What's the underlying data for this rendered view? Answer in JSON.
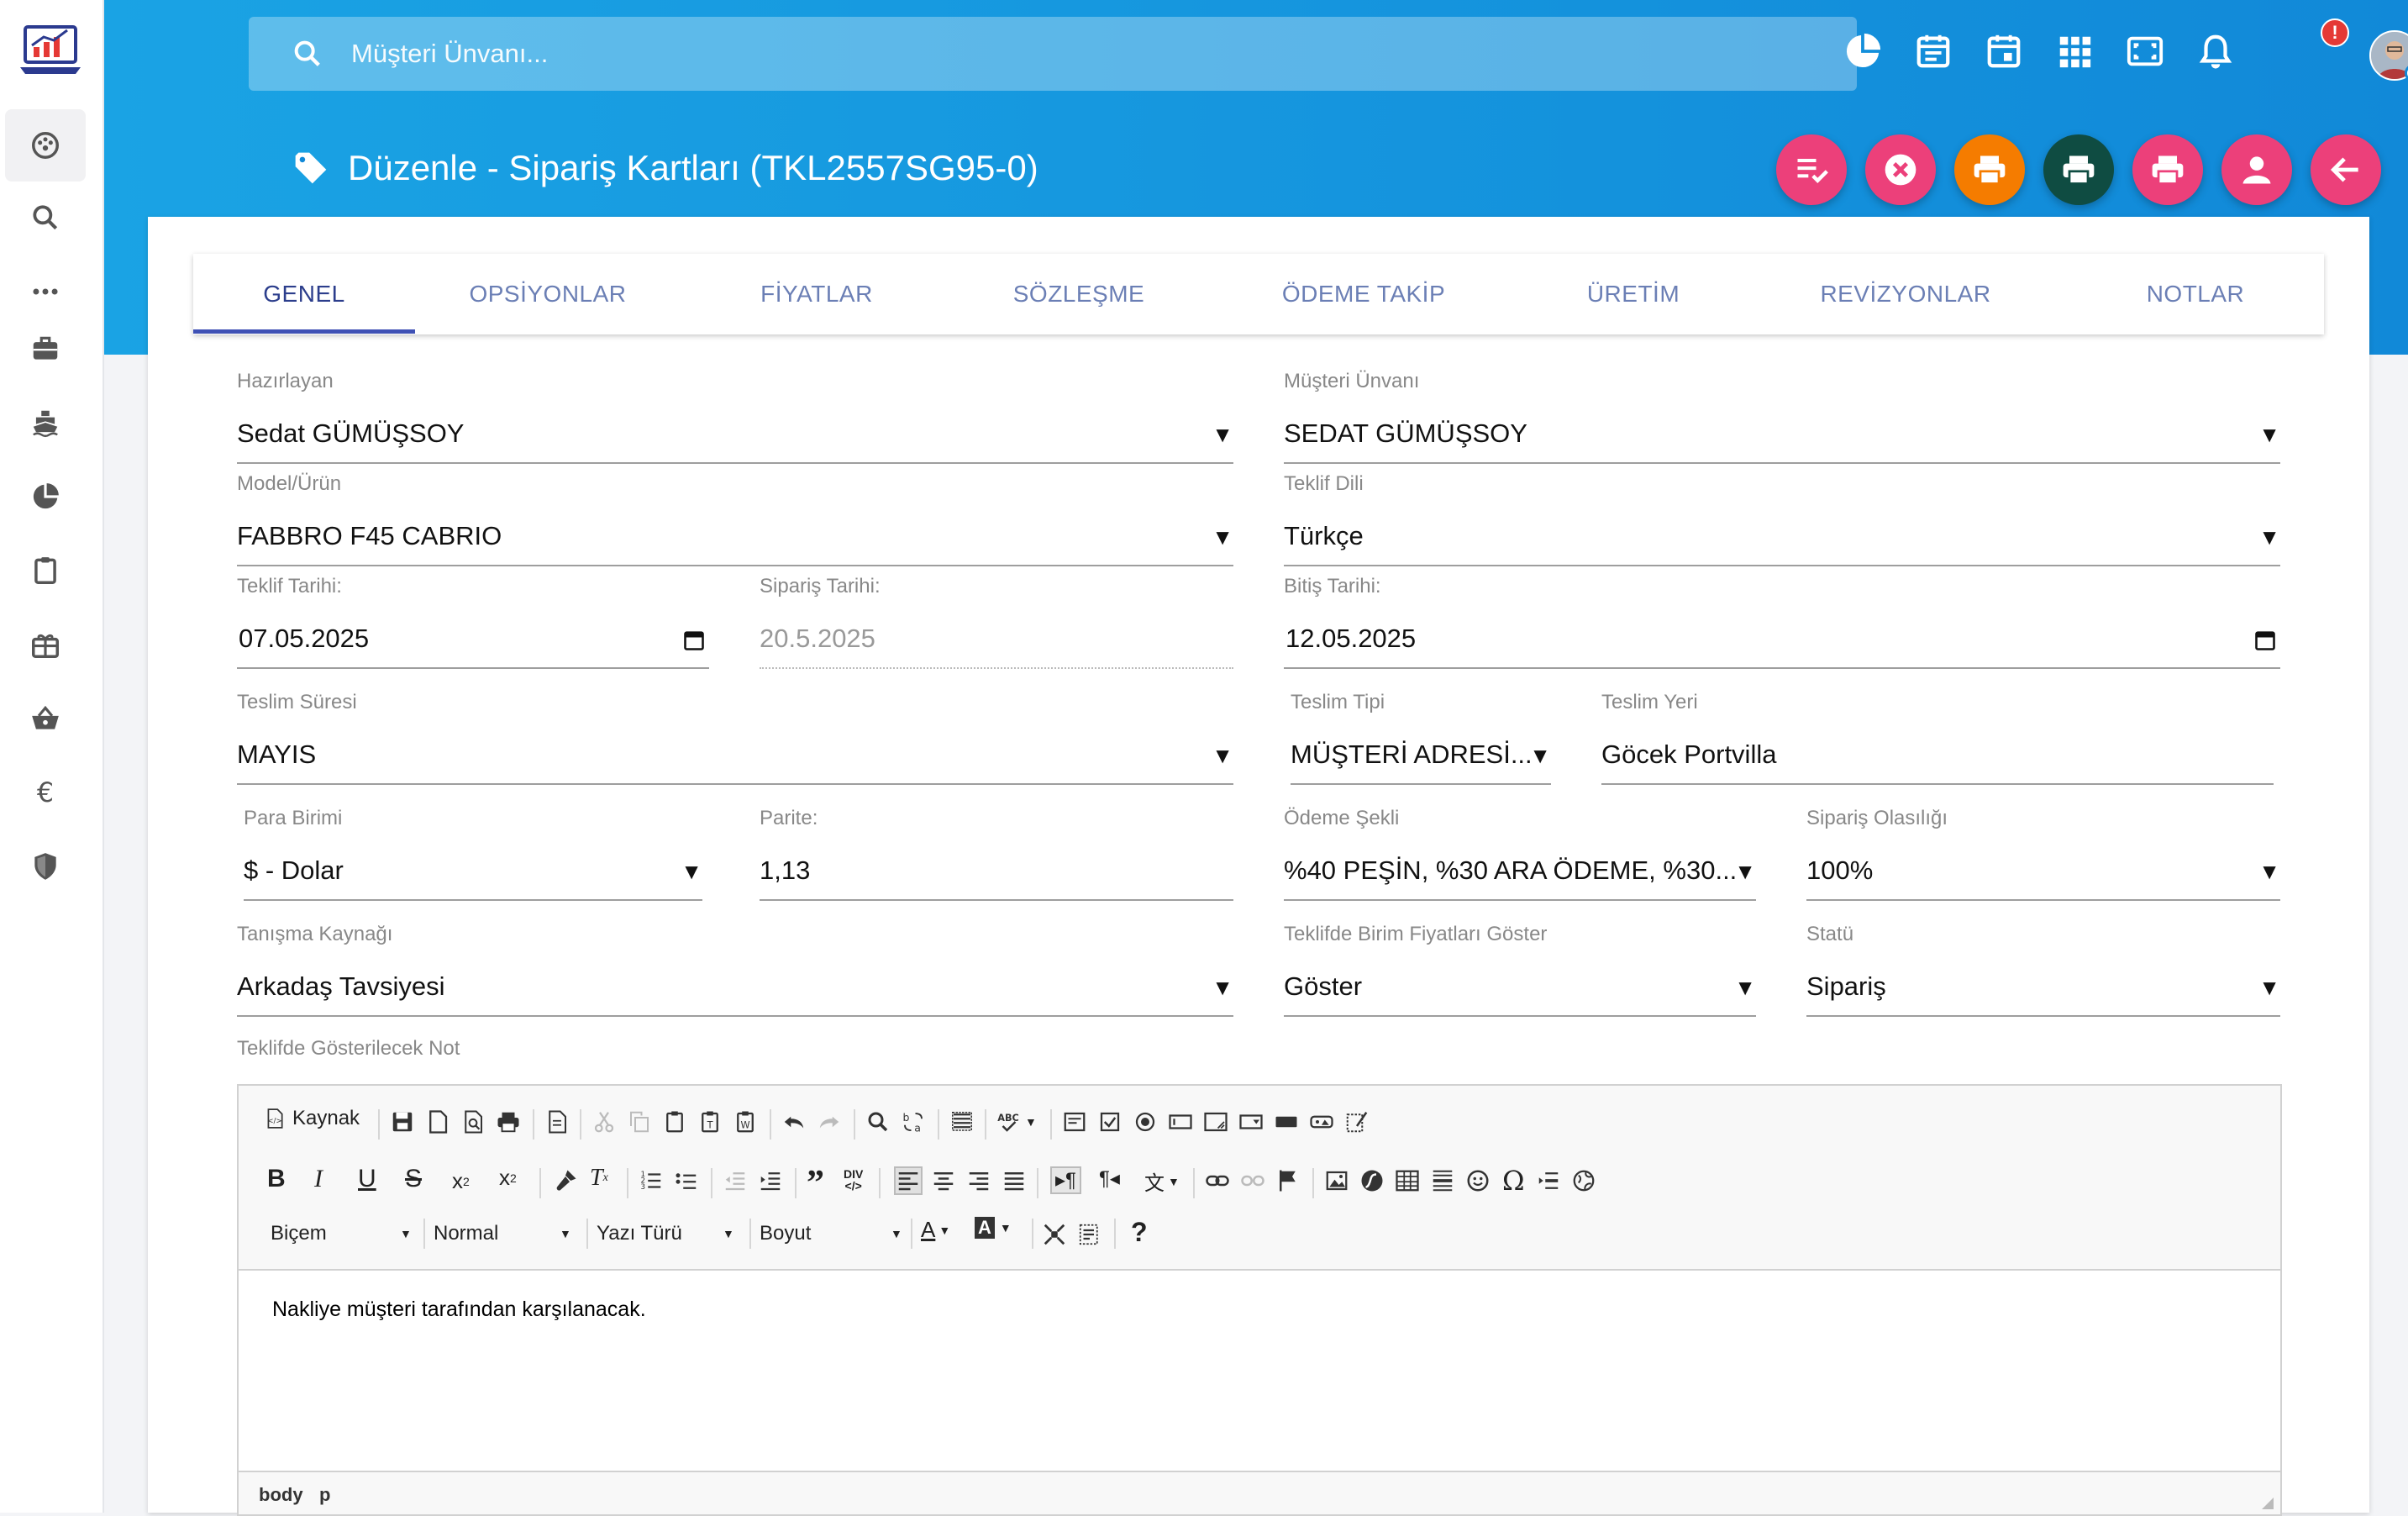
{
  "search": {
    "placeholder": "Müşteri Ünvanı..."
  },
  "page": {
    "title": "Düzenle - Sipariş Kartları (TKL2557SG95-0)"
  },
  "notification": {
    "badge": "!"
  },
  "colors": {
    "header_blue": "#1189d8",
    "pink": "#ec407a",
    "orange": "#f57c00",
    "dark_teal": "#0f4c42",
    "tab_active": "#3f51b5"
  },
  "sidebar_icons": [
    "dashboard-icon",
    "search-icon",
    "more-icon",
    "briefcase-icon",
    "ship-icon",
    "pie-chart-icon",
    "clipboard-icon",
    "gift-icon",
    "basket-icon",
    "euro-icon",
    "shield-icon"
  ],
  "tabs": [
    "GENEL",
    "OPSİYONLAR",
    "FİYATLAR",
    "SÖZLEŞME",
    "ÖDEME TAKİP",
    "ÜRETİM",
    "REVİZYONLAR",
    "NOTLAR"
  ],
  "form": {
    "hazirlayan": {
      "label": "Hazırlayan",
      "value": "Sedat GÜMÜŞSOY"
    },
    "musteri": {
      "label": "Müşteri Ünvanı",
      "value": "SEDAT GÜMÜŞSOY"
    },
    "model": {
      "label": "Model/Ürün",
      "value": "FABBRO F45 CABRIO"
    },
    "teklif_dili": {
      "label": "Teklif Dili",
      "value": "Türkçe"
    },
    "teklif_tarihi": {
      "label": "Teklif Tarihi:",
      "value": "07.05.2025"
    },
    "siparis_tarihi": {
      "label": "Sipariş Tarihi:",
      "value": "20.5.2025"
    },
    "bitis_tarihi": {
      "label": "Bitiş Tarihi:",
      "value": "12.05.2025"
    },
    "teslim_suresi": {
      "label": "Teslim Süresi",
      "value": "MAYIS"
    },
    "teslim_tipi": {
      "label": "Teslim Tipi",
      "value": "MÜŞTERİ ADRESİ..."
    },
    "teslim_yeri": {
      "label": "Teslim Yeri",
      "value": "Göcek Portvilla"
    },
    "para_birimi": {
      "label": "Para Birimi",
      "value": "$ - Dolar"
    },
    "parite": {
      "label": "Parite:",
      "value": "1,13"
    },
    "odeme_sekli": {
      "label": "Ödeme Şekli",
      "value": "%40 PEŞİN, %30 ARA ÖDEME, %30..."
    },
    "siparis_olasiligi": {
      "label": "Sipariş Olasılığı",
      "value": "100%"
    },
    "tanisma": {
      "label": "Tanışma Kaynağı",
      "value": "Arkadaş Tavsiyesi"
    },
    "birim_fiyat": {
      "label": "Teklifde Birim Fiyatları Göster",
      "value": "Göster"
    },
    "statu": {
      "label": "Statü",
      "value": "Sipariş"
    },
    "not": {
      "label": "Teklifde Gösterilecek Not"
    }
  },
  "editor": {
    "source_label": "Kaynak",
    "format_label": "Biçem",
    "paragraph_label": "Normal",
    "font_label": "Yazı Türü",
    "size_label": "Boyut",
    "content": "Nakliye müşteri tarafından karşılanacak.",
    "path": [
      "body",
      "p"
    ]
  }
}
